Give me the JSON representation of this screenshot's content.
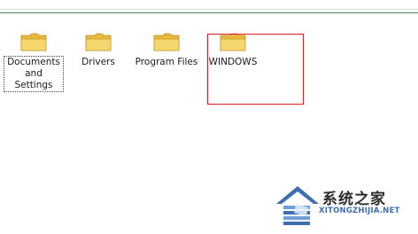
{
  "folders": [
    {
      "name": "Documents\nand Settings",
      "focused": true
    },
    {
      "name": "Drivers",
      "focused": false
    },
    {
      "name": "Program Files",
      "focused": false
    },
    {
      "name": "WINDOWS",
      "focused": false
    }
  ],
  "watermark": {
    "title": "系统之家",
    "url": "XITONGZHIJIA.NET"
  },
  "colors": {
    "highlight": "#d81e1e",
    "folder_body": "#f5d76e",
    "folder_back": "#e8b93c",
    "watermark_blue": "#3d6fb0"
  },
  "icons": {
    "folder": "folder-icon",
    "watermark_logo": "house-logo-icon"
  }
}
